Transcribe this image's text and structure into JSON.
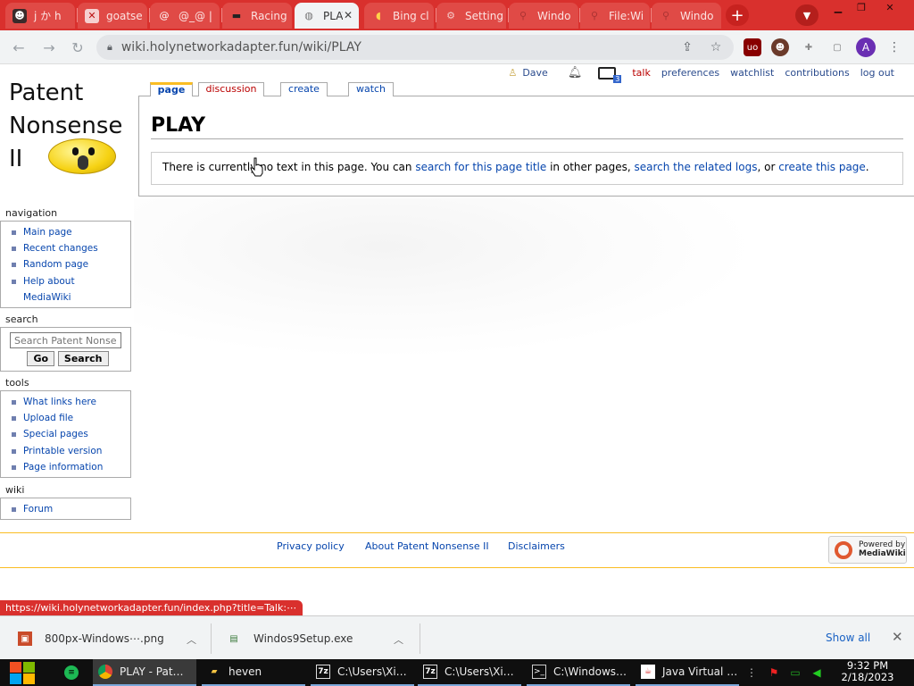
{
  "browser": {
    "tabs": [
      {
        "title": "j か h",
        "icon": "anime-face-icon"
      },
      {
        "title": "goatse",
        "icon": "butterfly-icon"
      },
      {
        "title": "@_@ |",
        "icon": "at-sign-icon"
      },
      {
        "title": "Racing",
        "icon": "car-icon"
      },
      {
        "title": "PLAY",
        "icon": "globe-icon",
        "active": true
      },
      {
        "title": "Bing cl",
        "icon": "bing-chat-icon"
      },
      {
        "title": "Setting",
        "icon": "gear-icon"
      },
      {
        "title": "Windo",
        "icon": "wiki-icon"
      },
      {
        "title": "File:Wi",
        "icon": "wiki-icon"
      },
      {
        "title": "Windo",
        "icon": "wiki-icon"
      }
    ],
    "new_tab": "+",
    "address": "wiki.holynetworkadapter.fun/wiki/PLAY",
    "extension_badge": "3",
    "profile_initial": "A",
    "accent": "#d9302d"
  },
  "wiki": {
    "logo_lines": [
      "Patent",
      "Nonsense",
      "II"
    ],
    "personal": {
      "user": "Dave",
      "notifications_count": "3",
      "talk": "talk",
      "preferences": "preferences",
      "watchlist": "watchlist",
      "contributions": "contributions",
      "logout": "log out"
    },
    "tabs": {
      "page": "page",
      "discussion": "discussion",
      "create": "create",
      "watch": "watch"
    },
    "title": "PLAY",
    "notice": {
      "pre": "There is currently no text in this page. You can ",
      "link1": "search for this page title",
      "mid1": " in other pages, ",
      "link2": "search the related logs",
      "mid2": ", or ",
      "link3": "create this page",
      "post": "."
    },
    "navigation": {
      "heading": "navigation",
      "items": [
        "Main page",
        "Recent changes",
        "Random page",
        "Help about MediaWiki"
      ]
    },
    "search": {
      "heading": "search",
      "placeholder": "Search Patent Nonsense II",
      "go": "Go",
      "search": "Search"
    },
    "tools": {
      "heading": "tools",
      "items": [
        "What links here",
        "Upload file",
        "Special pages",
        "Printable version",
        "Page information"
      ]
    },
    "wiki_box": {
      "heading": "wiki",
      "items": [
        "Forum"
      ]
    },
    "footer": {
      "privacy": "Privacy policy",
      "about": "About Patent Nonsense II",
      "disclaimers": "Disclaimers",
      "powered_line1": "Powered by",
      "powered_line2": "MediaWiki"
    }
  },
  "status_url": "https://wiki.holynetworkadapter.fun/index.php?title=Talk:⋯",
  "downloads": {
    "items": [
      {
        "name": "800px-Windows⋯.png",
        "icon": "image-file-icon"
      },
      {
        "name": "Windos9Setup.exe",
        "icon": "installer-icon"
      }
    ],
    "show_all": "Show all"
  },
  "taskbar": {
    "items": [
      {
        "label": "PLAY - Pat…",
        "icon": "chrome-icon"
      },
      {
        "label": "heven",
        "icon": "folder-icon"
      },
      {
        "label": "C:\\Users\\Xi…",
        "icon": "7zip-icon"
      },
      {
        "label": "C:\\Users\\Xi…",
        "icon": "7zip-icon"
      },
      {
        "label": "C:\\Windows…",
        "icon": "cmd-icon"
      },
      {
        "label": "Java Virtual …",
        "icon": "java-icon"
      }
    ],
    "time": "9:32 PM",
    "date": "2/18/2023"
  }
}
